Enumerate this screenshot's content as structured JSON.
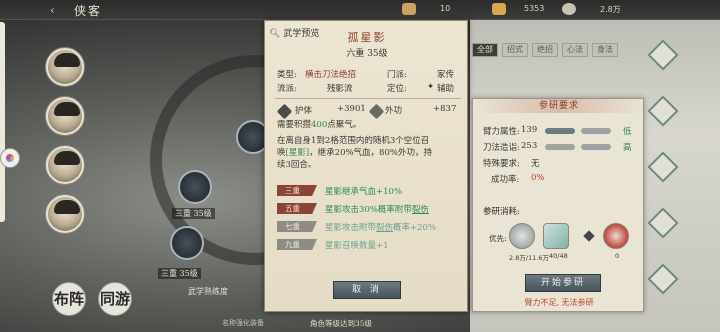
{
  "topbar": {
    "title": "侠客",
    "resource1": "10",
    "resource2": "5353",
    "resource3": "2.8万"
  },
  "colors": {
    "accent_red": "#8b3f2e",
    "green": "#2d8a4e",
    "teal": "#3f8f77",
    "button": "#5b676e"
  },
  "scene": {
    "skill_label_1": "三重 35级",
    "skill_label_2": "三重 35级",
    "scroll_title": "武学熟练度",
    "bottom_icon_1": "布阵",
    "bottom_icon_2": "同游",
    "bottom_caption_1": "名称强化装备",
    "bottom_caption_2": "角色等级达到35级"
  },
  "tabs": [
    "全部",
    "招式",
    "绝招",
    "心法",
    "身法"
  ],
  "card": {
    "header_tag": "武学预览",
    "title": "孤星影",
    "rank": "六重 35级",
    "type_label": "类型:",
    "type_value": "横击刀法绝招",
    "school_label": "流派:",
    "school_value": "残影流",
    "sect_label": "门派:",
    "sect_value": "家传",
    "position_label": "定位:",
    "position_value": "辅助",
    "stat1_label": "护体",
    "stat1_value": "+3901",
    "stat2_label": "外功",
    "stat2_value": "+837",
    "energy_pre": "需要积攒",
    "energy_value": "400",
    "energy_post": "点聚气。",
    "desc_a": "在离自身1到2格范围内的随机3个空位召",
    "desc_b_pre": "唤",
    "desc_b_hl": "[星影]",
    "desc_b_post": "，继承20%气血，80%外功，持",
    "desc_c": "续3回合。",
    "tiers": [
      {
        "badge": "三重",
        "text": "星影继承气血+10%",
        "style": "green"
      },
      {
        "badge": "五重",
        "text": "星影攻击30%概率附带",
        "hl": "裂伤",
        "style": "green"
      },
      {
        "badge": "七重",
        "text": "星影攻击附带",
        "hl": "裂伤",
        "text2": "概率+20%",
        "style": "teal"
      },
      {
        "badge": "九重",
        "text": "星影召唤数量+1",
        "style": "teal"
      }
    ],
    "cancel_label": "取 消"
  },
  "research": {
    "title": "参研要求",
    "rows": [
      {
        "label": "臂力属性:",
        "value": "139",
        "result": "低"
      },
      {
        "label": "刀法造诣:",
        "value": "253",
        "result": "高"
      }
    ],
    "special_label": "特殊要求:",
    "special_value": "无",
    "success_label": "成功率:",
    "success_value": "0%",
    "consume_label": "参研消耗:",
    "priority_label": "优先:",
    "item1_count": "2.8万/11.6万",
    "item2_count": "40/48",
    "item3_count": "0",
    "start_label": "开始参研",
    "warning": "臂力不足, 无法参研"
  }
}
